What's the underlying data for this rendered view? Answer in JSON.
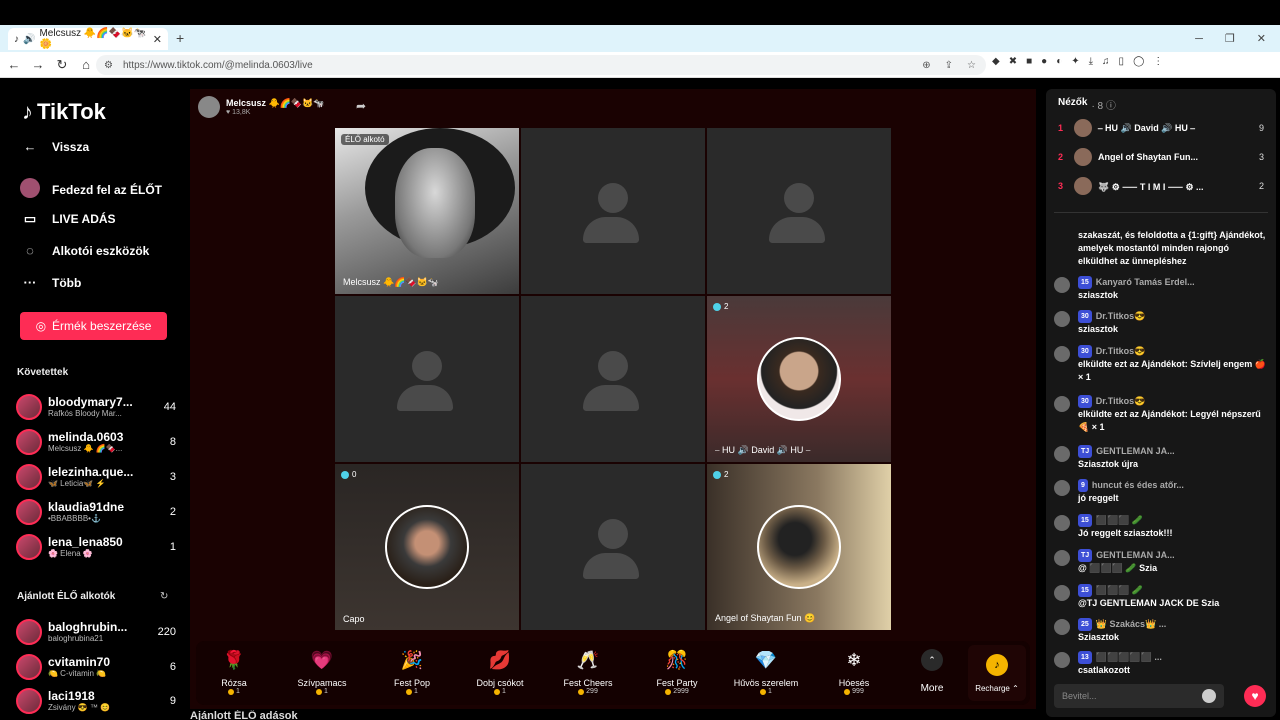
{
  "browser": {
    "tab_title": "Melcsusz 🐥🌈🍫🐱🐄🌼",
    "url": "https://www.tiktok.com/@melinda.0603/live"
  },
  "sidebar": {
    "logo": "TikTok",
    "nav": [
      {
        "label": "Vissza",
        "icon": "arrow-left-icon"
      },
      {
        "label": "Fedezd fel az ÉLŐT",
        "icon": "avatar-icon"
      },
      {
        "label": "LIVE ADÁS",
        "icon": "video-icon"
      },
      {
        "label": "Alkotói eszközök",
        "icon": "lightbulb-icon"
      },
      {
        "label": "Több",
        "icon": "more-icon"
      }
    ],
    "coins_button": "Érmék beszerzése",
    "following_header": "Követettek",
    "following": [
      {
        "name": "bloodymary7...",
        "sub": "Rafkós Bloody Mar...",
        "count": "44"
      },
      {
        "name": "melinda.0603",
        "sub": "Melcsusz 🐥 🌈🍫...",
        "count": "8"
      },
      {
        "name": "lelezinha.que...",
        "sub": "🦋 Leticia🦋 ⚡",
        "count": "3"
      },
      {
        "name": "klaudia91dne",
        "sub": "•BBABBBB•⚓",
        "count": "2"
      },
      {
        "name": "lena_lena850",
        "sub": "🌸 Elena 🌸",
        "count": "1"
      }
    ],
    "recommended_header": "Ajánlott ÉLŐ alkotók",
    "recommended": [
      {
        "name": "baloghrubin...",
        "sub": "baloghrubina21",
        "count": "220"
      },
      {
        "name": "cvitamin70",
        "sub": "🍋 C-vitamin 🍋",
        "count": "6"
      },
      {
        "name": "laci1918",
        "sub": "Zsivány 😎 ™ 😊",
        "count": "9"
      }
    ]
  },
  "stream": {
    "host_name": "Melcsusz 🐥🌈🍫🐱🐄",
    "host_likes": "♥ 13,8K",
    "host_tag": "ÉLŐ alkotó",
    "host_label": "Melcsusz 🐥🌈🍫🐱🐄",
    "cells": [
      {
        "label": "",
        "badge": ""
      },
      {
        "label": "",
        "badge": ""
      },
      {
        "label": "",
        "badge": ""
      },
      {
        "label": "",
        "badge": ""
      },
      {
        "label": "⎯ HU 🔊 David 🔊 HU ⎯",
        "badge": "2"
      },
      {
        "label": "Capo",
        "badge": "0"
      },
      {
        "label": "",
        "badge": ""
      },
      {
        "label": "Angel of Shaytan Fun 😊",
        "badge": "2"
      }
    ]
  },
  "gifts": [
    {
      "name": "Rózsa",
      "price": "1",
      "icon": "🌹"
    },
    {
      "name": "Szívpamacs",
      "price": "1",
      "icon": "💗"
    },
    {
      "name": "Fest Pop",
      "price": "1",
      "icon": "🎉"
    },
    {
      "name": "Dobj csókot",
      "price": "1",
      "icon": "💋"
    },
    {
      "name": "Fest Cheers",
      "price": "299",
      "icon": "🥂"
    },
    {
      "name": "Fest Party",
      "price": "2999",
      "icon": "🎊"
    },
    {
      "name": "Hűvös szerelem",
      "price": "1",
      "icon": "💎"
    },
    {
      "name": "Hóesés",
      "price": "999",
      "icon": "❄"
    }
  ],
  "more_label": "More",
  "recharge_label": "Recharge ⌃",
  "recommended_below": "Ajánlott ÉLŐ adások",
  "viewers": {
    "title": "Nézők",
    "count": "· 8 ⓘ",
    "list": [
      {
        "rank": "1",
        "name": "⎯ HU 🔊 David 🔊 HU ⎯",
        "score": "9"
      },
      {
        "rank": "2",
        "name": "Angel of Shaytan Fun...",
        "score": "3"
      },
      {
        "rank": "3",
        "name": "🐺 ⚙ ⸺ T I M I ⸺ ⚙ ...",
        "score": "2"
      }
    ]
  },
  "chat": [
    {
      "user": "",
      "lvl": "",
      "text": "szakaszát, és feloldotta a {1:gift} Ajándékot, amelyek mostantól minden rajongó elküldhet az ünnepléshez"
    },
    {
      "user": "Kanyaró Tamás Erdel...",
      "lvl": "15",
      "text": "sziasztok"
    },
    {
      "user": "Dr.Titkos😎",
      "lvl": "30",
      "text": "sziasztok"
    },
    {
      "user": "Dr.Titkos😎",
      "lvl": "30",
      "text": "elküldte ezt az Ajándékot: Szívlelj engem 🍎 × 1"
    },
    {
      "user": "Dr.Titkos😎",
      "lvl": "30",
      "text": "elküldte ezt az Ajándékot: Legyél népszerű 🍕 × 1"
    },
    {
      "user": "GENTLEMAN JA...",
      "lvl": "TJ",
      "text": "Sziasztok újra"
    },
    {
      "user": "huncut és édes atőr...",
      "lvl": "9",
      "text": "jó reggelt"
    },
    {
      "user": "⬛⬛⬛ 🥒",
      "lvl": "15",
      "text": "Jó reggelt sziasztok!!!"
    },
    {
      "user": "GENTLEMAN JA...",
      "lvl": "TJ",
      "text": "@ ⬛⬛⬛ 🥒 Szia"
    },
    {
      "user": "⬛⬛⬛ 🥒",
      "lvl": "15",
      "text": "@TJ GENTLEMAN JACK DE Szia"
    },
    {
      "user": "👑 Szakács👑 ...",
      "lvl": "25",
      "text": "Sziasztok"
    },
    {
      "user": "⬛⬛⬛⬛⬛ ...",
      "lvl": "13",
      "text": "csatlakozott"
    }
  ],
  "input_placeholder": "Bevitel..."
}
